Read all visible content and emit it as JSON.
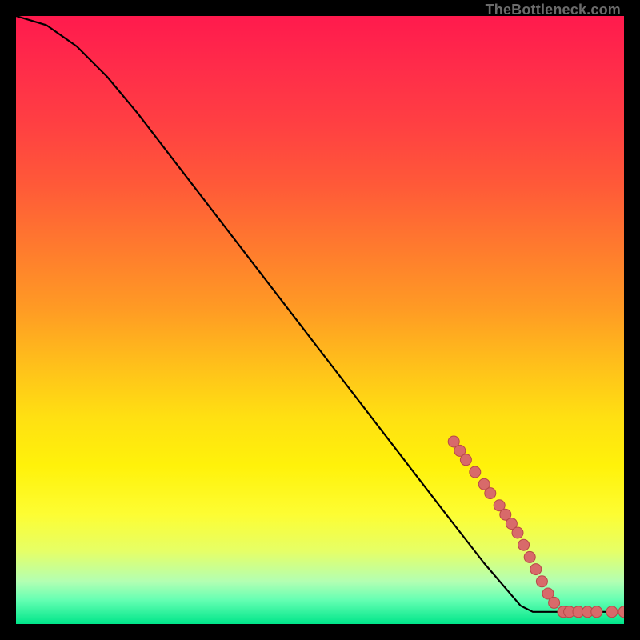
{
  "watermark": "TheBottleneck.com",
  "colors": {
    "dot_fill": "#d86a6a",
    "dot_stroke": "#b84848",
    "curve": "#000000"
  },
  "chart_data": {
    "type": "line",
    "title": "",
    "xlabel": "",
    "ylabel": "",
    "xlim": [
      0,
      100
    ],
    "ylim": [
      0,
      100
    ],
    "grid": false,
    "curve": [
      {
        "x": 0,
        "y": 100
      },
      {
        "x": 5,
        "y": 98.5
      },
      {
        "x": 10,
        "y": 95
      },
      {
        "x": 15,
        "y": 90
      },
      {
        "x": 20,
        "y": 84
      },
      {
        "x": 30,
        "y": 71
      },
      {
        "x": 40,
        "y": 58
      },
      {
        "x": 50,
        "y": 45
      },
      {
        "x": 60,
        "y": 32
      },
      {
        "x": 70,
        "y": 19
      },
      {
        "x": 77,
        "y": 10
      },
      {
        "x": 83,
        "y": 3
      },
      {
        "x": 85,
        "y": 2
      },
      {
        "x": 88,
        "y": 2
      },
      {
        "x": 92,
        "y": 2
      },
      {
        "x": 96,
        "y": 2
      },
      {
        "x": 100,
        "y": 2
      }
    ],
    "highlighted_points": [
      {
        "x": 72,
        "y": 30
      },
      {
        "x": 73,
        "y": 28.5
      },
      {
        "x": 74,
        "y": 27
      },
      {
        "x": 75.5,
        "y": 25
      },
      {
        "x": 77,
        "y": 23
      },
      {
        "x": 78,
        "y": 21.5
      },
      {
        "x": 79.5,
        "y": 19.5
      },
      {
        "x": 80.5,
        "y": 18
      },
      {
        "x": 81.5,
        "y": 16.5
      },
      {
        "x": 82.5,
        "y": 15
      },
      {
        "x": 83.5,
        "y": 13
      },
      {
        "x": 84.5,
        "y": 11
      },
      {
        "x": 85.5,
        "y": 9
      },
      {
        "x": 86.5,
        "y": 7
      },
      {
        "x": 87.5,
        "y": 5
      },
      {
        "x": 88.5,
        "y": 3.5
      },
      {
        "x": 90,
        "y": 2
      },
      {
        "x": 91,
        "y": 2
      },
      {
        "x": 92.5,
        "y": 2
      },
      {
        "x": 94,
        "y": 2
      },
      {
        "x": 95.5,
        "y": 2
      },
      {
        "x": 98,
        "y": 2
      },
      {
        "x": 100,
        "y": 2
      }
    ]
  }
}
